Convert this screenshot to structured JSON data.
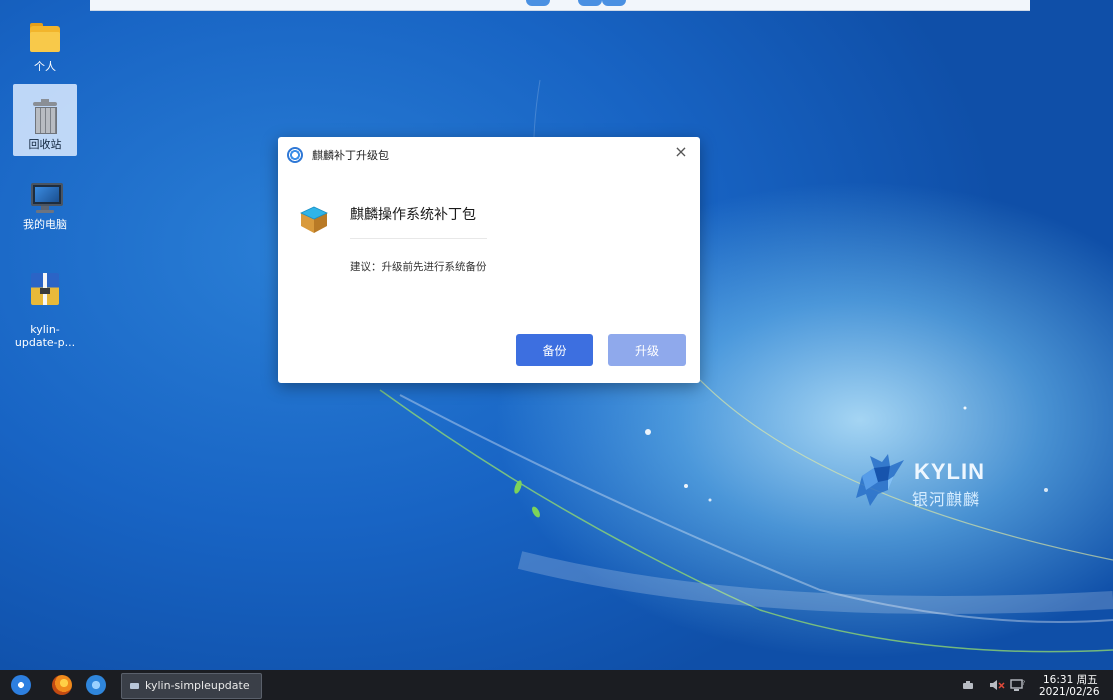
{
  "desktop": {
    "icons": [
      {
        "label": "个人"
      },
      {
        "label": "回收站"
      },
      {
        "label": "我的电脑"
      },
      {
        "label": "kylin-\nupdate-p..."
      }
    ],
    "brand": {
      "text": "KYLIN",
      "subtext": "银河麒麟"
    }
  },
  "dialog": {
    "title": "麒麟补丁升级包",
    "close_glyph": "×",
    "heading": "麒麟操作系统补丁包",
    "advice": "建议：升级前先进行系统备份",
    "backup_label": "备份",
    "upgrade_label": "升级",
    "colors": {
      "primary": "#3d6fe0",
      "primary_light": "#8fa9ec"
    }
  },
  "taskbar": {
    "task_label": "kylin-simpleupdate",
    "clock_time": "16:31 周五",
    "clock_date": "2021/02/26"
  }
}
